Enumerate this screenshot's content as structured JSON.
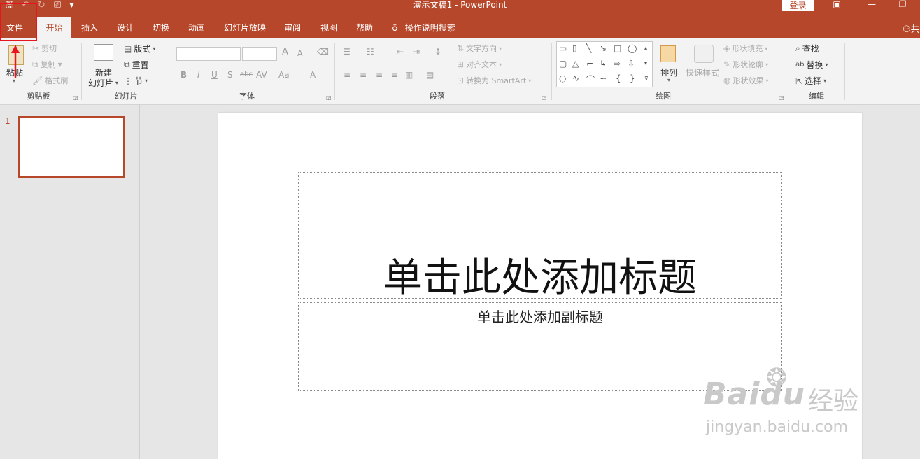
{
  "app": {
    "title": "演示文稿1  -  PowerPoint",
    "login_label": "登录"
  },
  "qat": {
    "save_icon": "save-icon",
    "undo_icon": "undo-icon",
    "redo_icon": "redo-icon",
    "present_icon": "present-icon",
    "customize_icon": "customize-icon"
  },
  "window_controls": {
    "ribbon_display": "▣",
    "minimize": "—",
    "restore": "❐"
  },
  "tabs": [
    {
      "label": "文件"
    },
    {
      "label": "开始"
    },
    {
      "label": "插入"
    },
    {
      "label": "设计"
    },
    {
      "label": "切换"
    },
    {
      "label": "动画"
    },
    {
      "label": "幻灯片放映"
    },
    {
      "label": "审阅"
    },
    {
      "label": "视图"
    },
    {
      "label": "帮助"
    }
  ],
  "active_tab": "开始",
  "tell_me": {
    "label": "操作说明搜索",
    "icon": "lightbulb-icon"
  },
  "user_label": "共",
  "ribbon": {
    "clipboard": {
      "paste": "粘贴",
      "cut": "剪切",
      "copy": "复制",
      "format_painter": "格式刷",
      "group_label": "剪贴板"
    },
    "slides": {
      "new_slide_line1": "新建",
      "new_slide_line2": "幻灯片",
      "layout": "版式",
      "reset": "重置",
      "section": "节",
      "group_label": "幻灯片"
    },
    "font": {
      "grow": "A",
      "shrink": "A",
      "bold": "B",
      "italic": "I",
      "underline": "U",
      "shadow": "S",
      "strike": "abc",
      "spacing": "AV",
      "case": "Aa",
      "color": "A",
      "group_label": "字体"
    },
    "paragraph": {
      "text_direction": "文字方向",
      "align_text": "对齐文本",
      "smartart": "转换为 SmartArt",
      "group_label": "段落"
    },
    "drawing": {
      "arrange": "排列",
      "quick_styles": "快速样式",
      "shape_fill": "形状填充",
      "shape_outline": "形状轮廓",
      "shape_effects": "形状效果",
      "group_label": "绘图"
    },
    "editing": {
      "find": "查找",
      "replace": "替换",
      "select": "选择",
      "group_label": "编辑"
    }
  },
  "thumbnails": [
    {
      "number": "1"
    }
  ],
  "slide": {
    "title_placeholder": "单击此处添加标题",
    "subtitle_placeholder": "单击此处添加副标题"
  },
  "watermark": {
    "logo": "Bai",
    "logo_tail": "du",
    "cn": "经验",
    "url": "jingyan.baidu.com"
  },
  "annotation_color": "#e8141e",
  "accent_color": "#b7472a"
}
